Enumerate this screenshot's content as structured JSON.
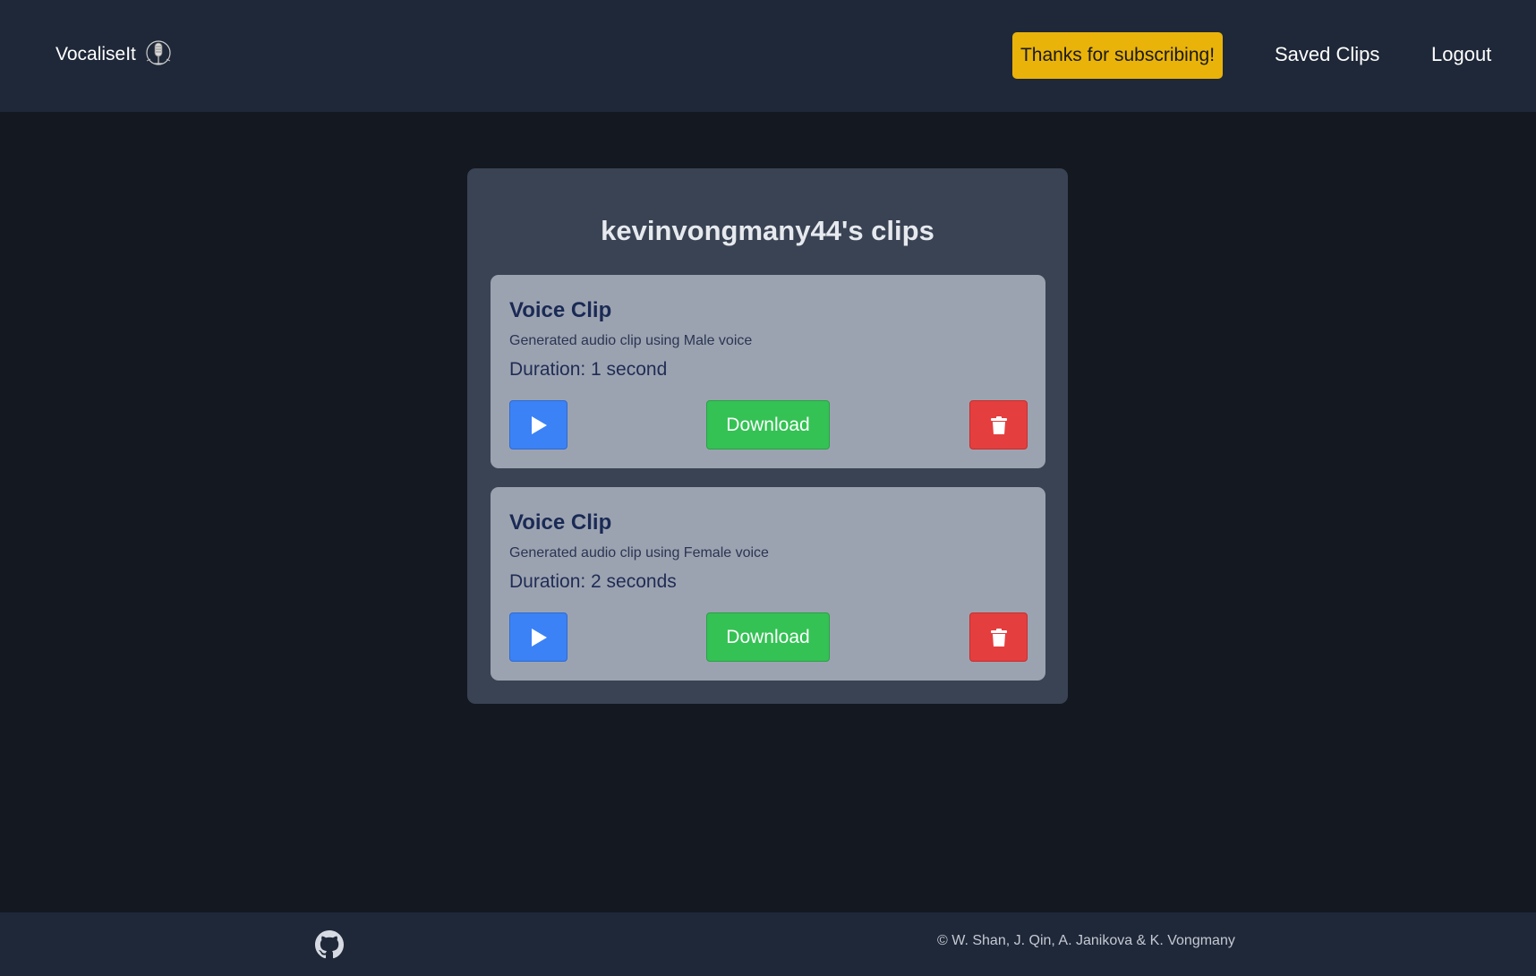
{
  "header": {
    "brand": "VocaliseIt",
    "subscribe_badge": "Thanks for subscribing!",
    "nav": {
      "saved_clips": "Saved Clips",
      "logout": "Logout"
    }
  },
  "main": {
    "title": "kevinvongmany44's clips",
    "clips": [
      {
        "title": "Voice Clip",
        "description": "Generated audio clip using Male voice",
        "duration": "Duration: 1 second",
        "download_label": "Download"
      },
      {
        "title": "Voice Clip",
        "description": "Generated audio clip using Female voice",
        "duration": "Duration: 2 seconds",
        "download_label": "Download"
      }
    ]
  },
  "footer": {
    "copyright": "© W. Shan, J. Qin, A. Janikova & K. Vongmany"
  },
  "icons": {
    "brand": "microphone-icon",
    "play": "play-icon",
    "delete": "trash-icon",
    "footer": "github-icon"
  },
  "colors": {
    "subscribe": "#e9b30a",
    "play": "#3b82f6",
    "download": "#34c254",
    "delete": "#e53e3e"
  }
}
